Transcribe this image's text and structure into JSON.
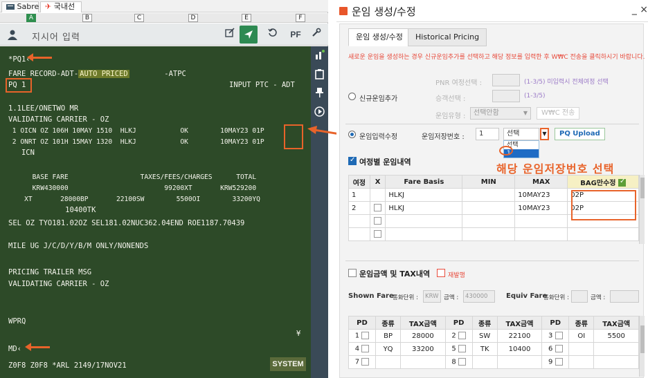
{
  "left": {
    "tabs": [
      {
        "label": "Sabre"
      },
      {
        "label": "국내선"
      }
    ],
    "area_letters": [
      "A",
      "B",
      "C",
      "D",
      "E",
      "F"
    ],
    "command": {
      "placeholder": "지시어 입력",
      "pf_label": "PF"
    },
    "terminal_lines": [
      "*PQ1‹",
      "FARE RECORD-ADT-",
      "AUTO PRICED",
      "        -ATPC",
      "PQ 1",
      "INPUT PTC - ADT",
      "1.1LEE/ONETWO MR",
      "VALIDATING CARRIER - OZ",
      " 1 OICN OZ 106H 10MAY 1510  HLKJ           OK        10MAY23 01P",
      " 2 ONRT OZ 101H 15MAY 1320  HLKJ           OK        10MAY23 01P",
      "   ICN",
      "      BASE FARE                  TAXES/FEES/CHARGES      TOTAL",
      "      KRW430000                        99200XT       KRW529200",
      "    XT       28000BP       22100SW        5500OI        33200YQ",
      "             10400TK",
      "SEL OZ TYO181.02OZ SEL181.02NUC362.04END ROE1187.70439",
      "MILE UG J/C/D/Y/B/M ONLY/NONENDS",
      "PRICING TRAILER MSG",
      "VALIDATING CARRIER - OZ",
      "WPRQ",
      "¥",
      "MD‹",
      "Z0F8 Z0F8 *ARL 2149/17NOV21"
    ],
    "system_button": "SYSTEM"
  },
  "dialog": {
    "title": "운임 생성/수정",
    "close": "_ ×",
    "tabs": [
      {
        "label": "운임 생성/수정",
        "active": true
      },
      {
        "label": "Historical Pricing",
        "active": false
      }
    ],
    "notice": "새로운 운임을 생성하는 경우 신규운임추가를 선택하고 해당 정보를 입력한 후 W₩C 전송을 클릭하시기 바랍니다.",
    "new_fare": {
      "radio_label": "신규운임추가",
      "pnr_label": "PNR 여정선택 :",
      "pnr_note": "(1-3/5) 미입력시 전체여정 선택",
      "pax_label": "승객선택 :",
      "pax_note": "(1-3/5)",
      "type_label": "운임유형 :",
      "type_value": "선택안함",
      "send_button": "W₩C 전송"
    },
    "edit_fare": {
      "radio_label": "운임입력수정",
      "store_no_label": "운임저장번호 :",
      "store_no_value": "1",
      "select_value": "선택",
      "dropdown_options": [
        "선택",
        "1"
      ],
      "upload_button": "PQ Upload"
    },
    "callout": "해당 운임저장번호 선택",
    "segment_section": {
      "title": "여정별 운임내역",
      "headers": [
        "여정",
        "X",
        "Fare Basis",
        "MIN",
        "MAX",
        "BAG만수정"
      ],
      "rows": [
        {
          "seg": "1",
          "fare_basis": "HLKJ",
          "min": "",
          "max": "10MAY23",
          "bag": "02P"
        },
        {
          "seg": "2",
          "fare_basis": "HLKJ",
          "min": "",
          "max": "10MAY23",
          "bag": "02P"
        },
        {
          "seg": "",
          "fare_basis": "",
          "min": "",
          "max": "",
          "bag": ""
        },
        {
          "seg": "",
          "fare_basis": "",
          "min": "",
          "max": "",
          "bag": ""
        }
      ]
    },
    "tax_section": {
      "title": "운임금액 및 TAX내역",
      "reissue": "재발행",
      "shown_fare_label": "Shown Fare",
      "currency_label": "통화단위 :",
      "currency_value": "KRW",
      "amount_label": "금액 :",
      "amount_value": "430000",
      "equiv_label": "Equiv Fare",
      "equiv_currency_label": "통화단위 :",
      "equiv_amount_label": "금액 :",
      "headers": [
        "PD",
        "종류",
        "TAX금액",
        "PD",
        "종류",
        "TAX금액",
        "PD",
        "종류",
        "TAX금액"
      ],
      "rows": [
        [
          "1",
          "BP",
          "28000",
          "2",
          "SW",
          "22100",
          "3",
          "OI",
          "5500"
        ],
        [
          "4",
          "YQ",
          "33200",
          "5",
          "TK",
          "10400",
          "6",
          "",
          ""
        ],
        [
          "7",
          "",
          "",
          "8",
          "",
          "",
          "9",
          "",
          ""
        ]
      ]
    }
  },
  "colors": {
    "terminal_bg": "#2d4a28",
    "accent_orange": "#e8632a",
    "brand_green": "#2d8a52",
    "notice_red": "#e74a3b"
  }
}
